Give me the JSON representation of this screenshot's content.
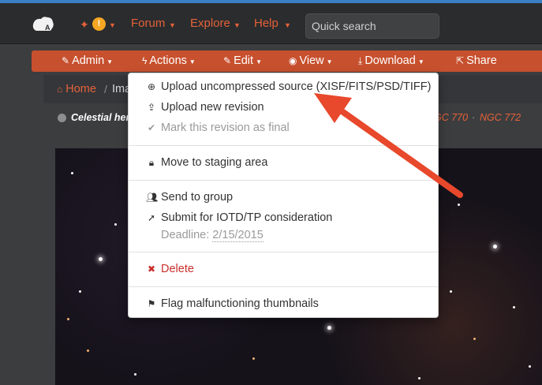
{
  "navbar": {
    "notif_count": "!",
    "items": [
      {
        "label": "Forum"
      },
      {
        "label": "Explore"
      },
      {
        "label": "Help"
      }
    ],
    "search_placeholder": "Quick search"
  },
  "subnav": {
    "items": [
      {
        "label": "Admin",
        "icon": "hammer-icon"
      },
      {
        "label": "Actions",
        "icon": "bolt-icon"
      },
      {
        "label": "Edit",
        "icon": "pencil-icon"
      },
      {
        "label": "View",
        "icon": "eye-icon"
      },
      {
        "label": "Download",
        "icon": "download-icon"
      },
      {
        "label": "Share",
        "icon": "share-icon"
      }
    ]
  },
  "breadcrumb": {
    "home": "Home",
    "current": "Ima"
  },
  "title": {
    "text": "Celestial hen",
    "tags": [
      "GC 770",
      "NGC 772"
    ],
    "separator": "·"
  },
  "dropdown": {
    "items": [
      {
        "label": "Upload uncompressed source (XISF/FITS/PSD/TIFF)",
        "icon": "upload-circle-icon",
        "state": "normal"
      },
      {
        "label": "Upload new revision",
        "icon": "upload-icon",
        "state": "normal"
      },
      {
        "label": "Mark this revision as final",
        "icon": "check-icon",
        "state": "disabled"
      },
      {
        "label": "Move to staging area",
        "icon": "lock-icon",
        "state": "normal"
      },
      {
        "label": "Send to group",
        "icon": "users-icon",
        "state": "normal"
      },
      {
        "label": "Submit for IOTD/TP consideration",
        "icon": "rocket-icon",
        "state": "normal"
      },
      {
        "label": "Delete",
        "icon": "close-icon",
        "state": "danger"
      },
      {
        "label": "Flag malfunctioning thumbnails",
        "icon": "flag-icon",
        "state": "normal"
      }
    ],
    "deadline_label": "Deadline:",
    "deadline_value": "2/15/2015"
  },
  "colors": {
    "accent": "#e4623a",
    "subnav_bg": "#c7502e",
    "navbar_bg": "#2b2c2e",
    "danger": "#c9302c",
    "annotation_arrow": "#e8482b"
  }
}
